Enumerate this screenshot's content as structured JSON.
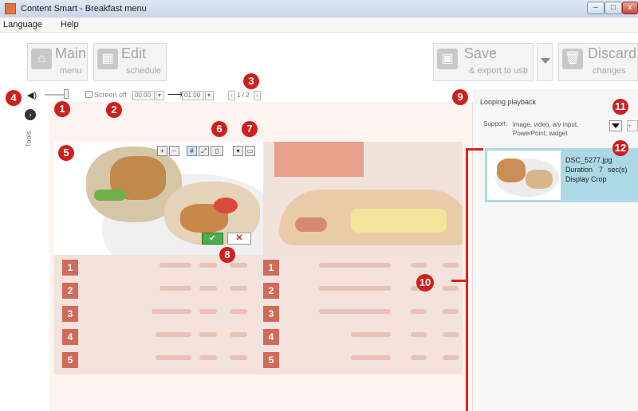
{
  "window": {
    "title": "Content Smart - Breakfast menu",
    "min": "–",
    "max": "□",
    "close": "x"
  },
  "menu": [
    "Language",
    "Help"
  ],
  "toolbar": {
    "main": {
      "line1": "Main",
      "line2": "menu"
    },
    "edit": {
      "line1": "Edit",
      "line2": "schedule"
    },
    "save": {
      "line1": "Save",
      "line2": "& export to usb"
    },
    "discard": {
      "line1": "Discard",
      "line2": "changes"
    }
  },
  "controls": {
    "screen_off": "Screen off",
    "time_from": "00:00",
    "time_to": "01:00",
    "page": "1 / 2"
  },
  "tools_label": "Tools",
  "right": {
    "looping": "Looping playback",
    "support_label": "Support:",
    "support_text": "image, video, a/v input, PowerPoint, widget"
  },
  "item": {
    "file": "DSC_5277.jpg",
    "duration_label": "Duration",
    "duration_value": "7",
    "duration_unit": "sec(s)",
    "display_label": "Display",
    "display_value": "Crop"
  },
  "callouts": [
    "1",
    "2",
    "3",
    "4",
    "5",
    "6",
    "7",
    "8",
    "9",
    "10",
    "11",
    "12"
  ],
  "colors": {
    "callout": "#cf1f1f",
    "accent": "#e0763d",
    "selection": "#add8e6"
  }
}
